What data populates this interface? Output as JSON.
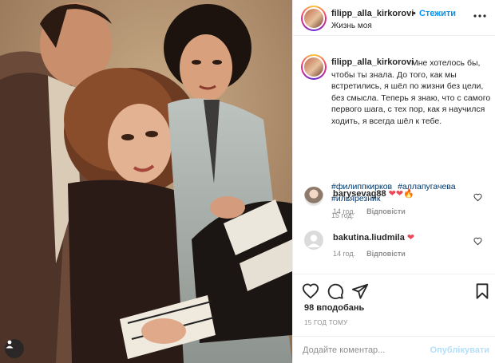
{
  "photo": {
    "alt_icon": "user-tag-icon"
  },
  "header": {
    "username": "filipp_alla_kirkorovi",
    "separator": "•",
    "follow_label": "Стежити",
    "subtitle": "Жизнь моя",
    "more_icon": "more-options-icon"
  },
  "caption": {
    "username": "filipp_alla_kirkorovi",
    "text": "Мне хотелось бы, чтобы ты знала. До того, как мы встретились, я шёл по жизни без цели, без смысла. Теперь я знаю, что с самого первого шага, с тех пор, как я научился ходить, я всегда шёл к тебе.",
    "hashtags": [
      "#филиппкирков",
      "#аллапугачева",
      "#ильярезник"
    ],
    "time": "15 год."
  },
  "comments": [
    {
      "username": "barysevag88",
      "emoji": "❤❤🔥",
      "time": "14 год.",
      "reply_label": "Відповісти"
    },
    {
      "username": "bakutina.liudmila",
      "emoji": "❤",
      "time": "14 год.",
      "reply_label": "Відповісти"
    }
  ],
  "actions": {
    "icons": [
      "heart-icon",
      "comment-icon",
      "share-icon",
      "bookmark-icon"
    ],
    "likes": "98 вподобань",
    "date": "15 ГОД ТОМУ"
  },
  "comment_box": {
    "placeholder": "Додайте коментар...",
    "publish_label": "Опублікувати"
  },
  "colors": {
    "link_blue": "#0095f6",
    "hashtag": "#00376b",
    "muted": "#8e8e8e",
    "heart_red": "#ed4956",
    "publish_disabled": "#b2dffc"
  }
}
